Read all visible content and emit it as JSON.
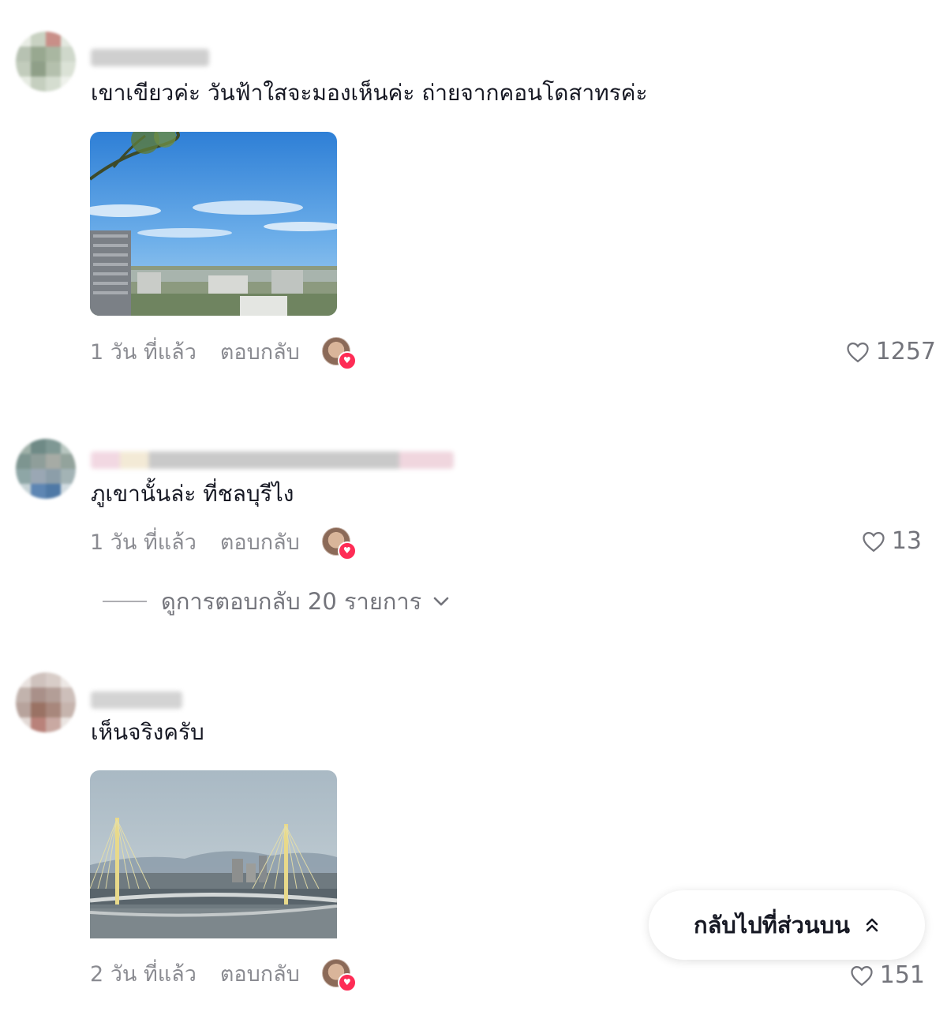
{
  "comments": [
    {
      "text": "เขาเขียวค่ะ วันฟ้าใสจะมองเห็นค่ะ ถ่ายจากคอนโดสาทรค่ะ",
      "time": "1 วัน ที่แล้ว",
      "reply": "ตอบกลับ",
      "likes": "1257"
    },
    {
      "text": "ภูเขานั้นล่ะ ที่ชลบุรีไง",
      "time": "1 วัน ที่แล้ว",
      "reply": "ตอบกลับ",
      "likes": "13"
    },
    {
      "text": "เห็นจริงครับ",
      "time": "2 วัน ที่แล้ว",
      "reply": "ตอบกลับ",
      "likes": "151"
    }
  ],
  "view_replies": "ดูการตอบกลับ 20 รายการ",
  "back_to_top": "กลับไปที่ส่วนบน",
  "colors": {
    "text": "#161823",
    "secondary": "rgba(22,24,35,0.5)",
    "accent": "#fe2c55"
  },
  "icons": [
    "heart-outline-icon",
    "chevron-down-icon",
    "double-chevron-up-icon",
    "heart-badge-icon"
  ]
}
